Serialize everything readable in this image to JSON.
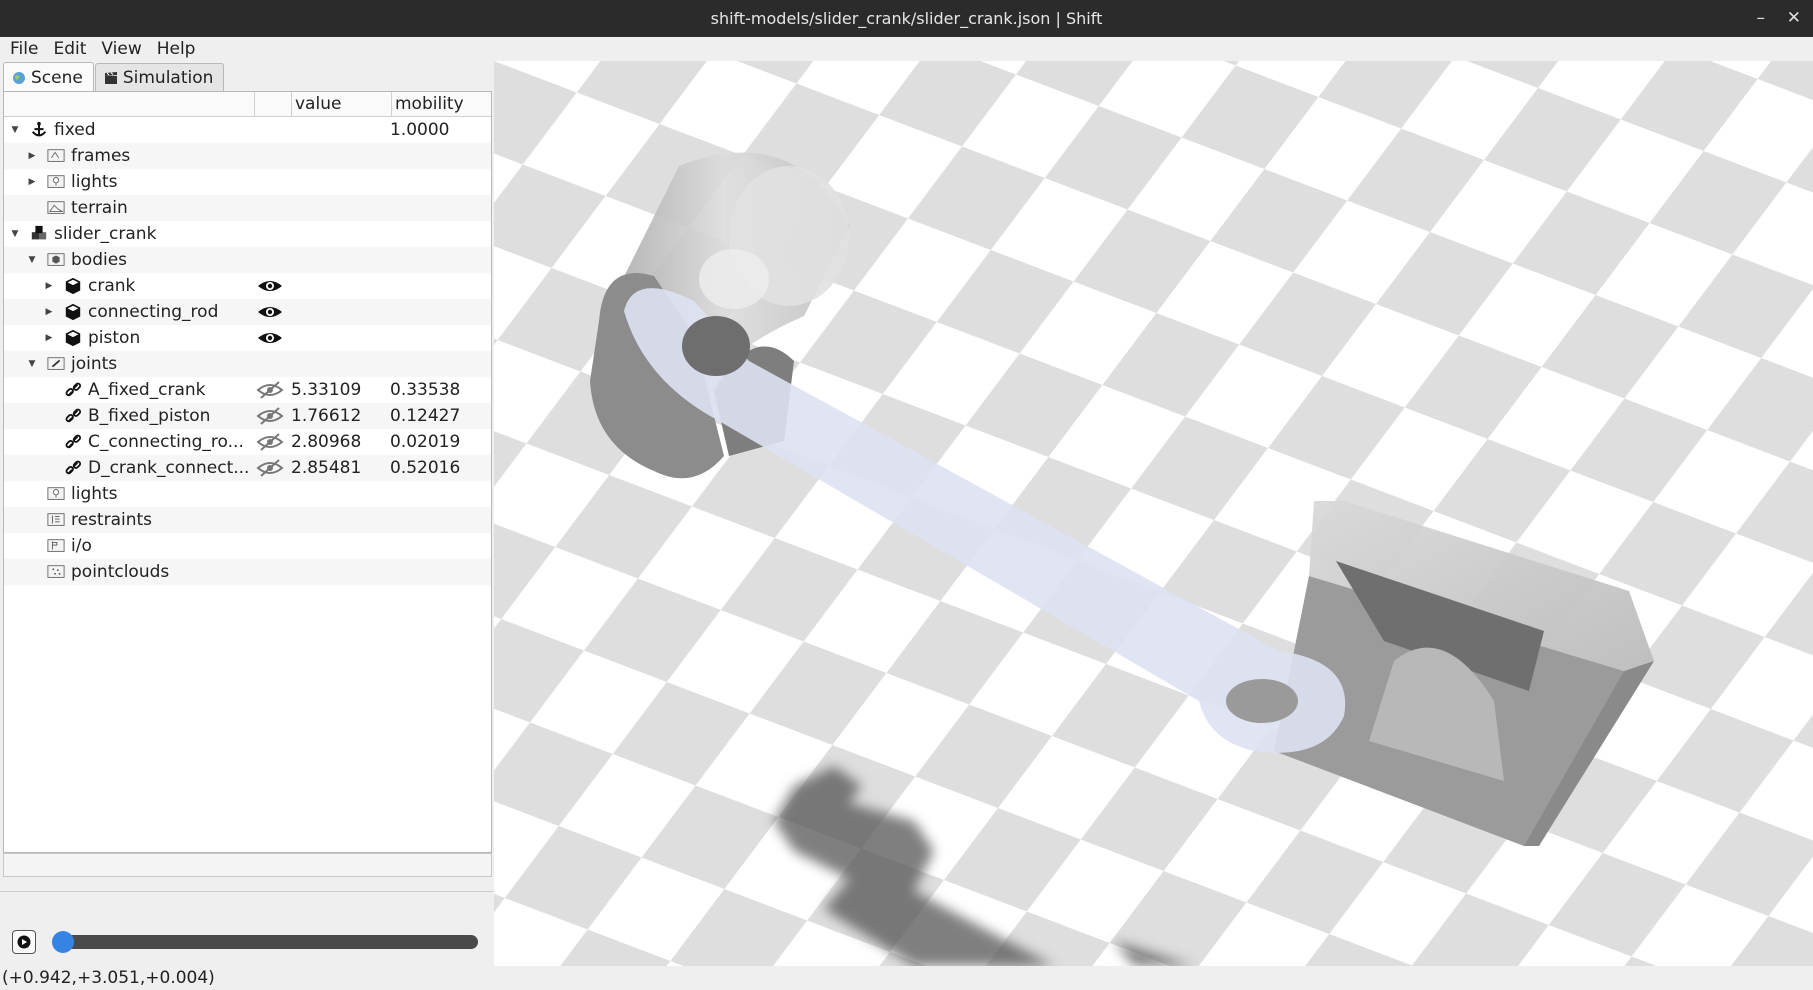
{
  "window": {
    "title": "shift-models/slider_crank/slider_crank.json | Shift",
    "minimize_glyph": "–",
    "close_glyph": "✕"
  },
  "menu": [
    "File",
    "Edit",
    "View",
    "Help"
  ],
  "tabs": [
    {
      "label": "Scene",
      "icon": "globe-icon",
      "active": true
    },
    {
      "label": "Simulation",
      "icon": "clapperboard-icon",
      "active": false
    }
  ],
  "tree": {
    "columns": [
      "",
      "",
      "value",
      "mobility"
    ],
    "rows": [
      {
        "level": 0,
        "expander": "expanded",
        "icon": "anchor-icon",
        "label": "fixed",
        "eye": "",
        "value": "",
        "mobility": "1.0000"
      },
      {
        "level": 1,
        "expander": "collapsed",
        "icon": "frames-icon",
        "label": "frames",
        "eye": "",
        "value": "",
        "mobility": ""
      },
      {
        "level": 1,
        "expander": "collapsed",
        "icon": "lights-icon",
        "label": "lights",
        "eye": "",
        "value": "",
        "mobility": ""
      },
      {
        "level": 1,
        "expander": "none",
        "icon": "terrain-icon",
        "label": "terrain",
        "eye": "",
        "value": "",
        "mobility": ""
      },
      {
        "level": 0,
        "expander": "expanded",
        "icon": "model-icon",
        "label": "slider_crank",
        "eye": "",
        "value": "",
        "mobility": ""
      },
      {
        "level": 1,
        "expander": "expanded",
        "icon": "bodies-icon",
        "label": "bodies",
        "eye": "",
        "value": "",
        "mobility": ""
      },
      {
        "level": 2,
        "expander": "collapsed",
        "icon": "body-cube-icon",
        "label": "crank",
        "eye": "visible",
        "value": "",
        "mobility": ""
      },
      {
        "level": 2,
        "expander": "collapsed",
        "icon": "body-cube-icon",
        "label": "connecting_rod",
        "eye": "visible",
        "value": "",
        "mobility": ""
      },
      {
        "level": 2,
        "expander": "collapsed",
        "icon": "body-cube-icon",
        "label": "piston",
        "eye": "visible",
        "value": "",
        "mobility": ""
      },
      {
        "level": 1,
        "expander": "expanded",
        "icon": "joints-icon",
        "label": "joints",
        "eye": "",
        "value": "",
        "mobility": ""
      },
      {
        "level": 2,
        "expander": "none",
        "icon": "joint-link-icon",
        "label": "A_fixed_crank",
        "eye": "hidden",
        "value": "5.33109",
        "mobility": "0.33538"
      },
      {
        "level": 2,
        "expander": "none",
        "icon": "joint-link-icon",
        "label": "B_fixed_piston",
        "eye": "hidden",
        "value": "1.76612",
        "mobility": "0.12427"
      },
      {
        "level": 2,
        "expander": "none",
        "icon": "joint-link-icon",
        "label": "C_connecting_ro...",
        "eye": "hidden",
        "value": "2.80968",
        "mobility": "0.02019"
      },
      {
        "level": 2,
        "expander": "none",
        "icon": "joint-link-icon",
        "label": "D_crank_connect...",
        "eye": "hidden",
        "value": "2.85481",
        "mobility": "0.52016"
      },
      {
        "level": 1,
        "expander": "none",
        "icon": "lights-icon",
        "label": "lights",
        "eye": "",
        "value": "",
        "mobility": ""
      },
      {
        "level": 1,
        "expander": "none",
        "icon": "restraints-icon",
        "label": "restraints",
        "eye": "",
        "value": "",
        "mobility": ""
      },
      {
        "level": 1,
        "expander": "none",
        "icon": "io-icon",
        "label": "i/o",
        "eye": "",
        "value": "",
        "mobility": ""
      },
      {
        "level": 1,
        "expander": "none",
        "icon": "pointclouds-icon",
        "label": "pointclouds",
        "eye": "",
        "value": "",
        "mobility": ""
      }
    ]
  },
  "player": {
    "play_icon": "play-icon",
    "progress": 0.0
  },
  "statusbar": {
    "coordinates": "(+0.942,+3.051,+0.004)"
  },
  "colors": {
    "titlebar": "#2b2b2b",
    "accent": "#3584e4",
    "floor_dark": "#dedede",
    "floor_light": "#ffffff",
    "rod": "#dde1f2",
    "part": "#a9a9a9"
  }
}
